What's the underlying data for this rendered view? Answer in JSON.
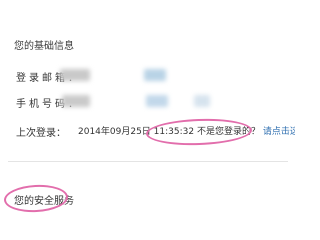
{
  "watermark": "",
  "basic_info": {
    "title": "您的基础信息",
    "email_label": "登录邮箱：",
    "phone_label": "手机号码：",
    "last_login_label": "上次登录：",
    "last_login_time": "2014年09月25日 11:35:32",
    "last_login_question": "不是您登录的？",
    "last_login_link": "请点击这里",
    "highlight_color": "#e26eac",
    "link_color": "#2f6fb0"
  },
  "security": {
    "title": "您的安全服务"
  }
}
